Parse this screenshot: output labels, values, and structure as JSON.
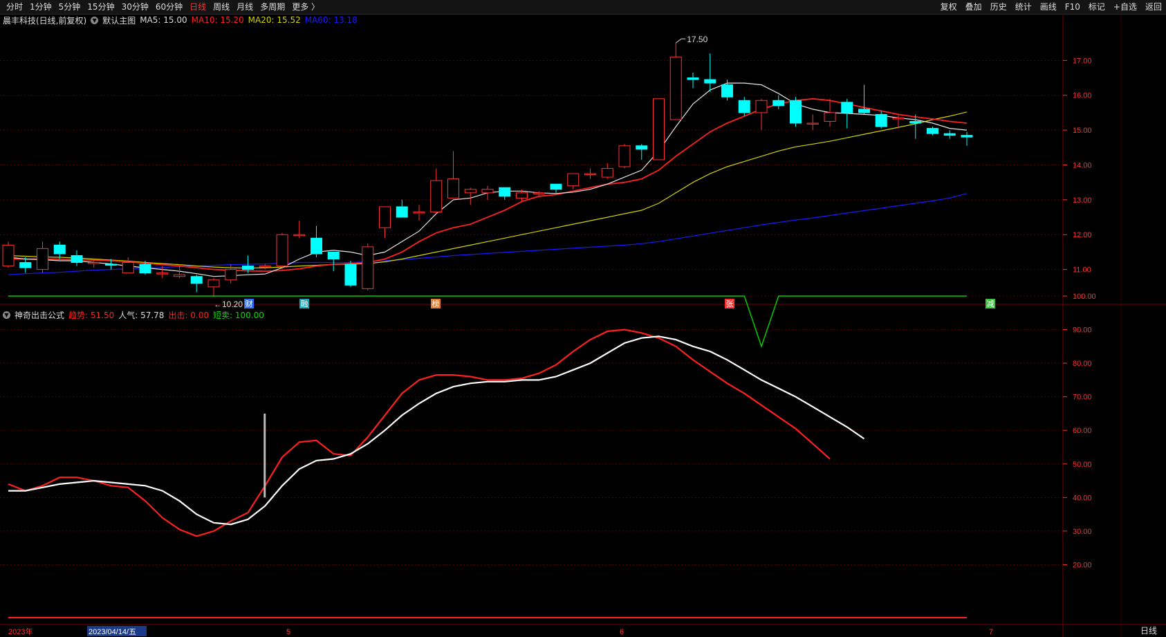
{
  "toolbar": {
    "periods": [
      "分时",
      "1分钟",
      "5分钟",
      "15分钟",
      "30分钟",
      "60分钟",
      "日线",
      "周线",
      "月线",
      "多周期",
      "更多 〉"
    ],
    "active_period": "日线",
    "right_buttons": [
      "复权",
      "叠加",
      "历史",
      "统计",
      "画线",
      "F10",
      "标记",
      "+自选",
      "返回"
    ]
  },
  "main_header": {
    "stock": "晨丰科技(日线,前复权)",
    "chart_name": "默认主图",
    "ma5": "MA5: 15.00",
    "ma10": "MA10: 15.20",
    "ma20": "MA20: 15.52",
    "ma60": "MA60: 13.18"
  },
  "indicator_header": {
    "name": "神奇出击公式",
    "trend": "趋势: 51.50",
    "popularity": "人气: 57.78",
    "attack": "出击: 0.00",
    "short_sell": "短卖: 100.00"
  },
  "colors": {
    "up": "#ff3232",
    "down": "#00ffff",
    "ma5": "#e8e8e8",
    "ma10": "#ff2020",
    "ma20": "#d4d400",
    "ma60": "#1a1aff",
    "grid": "#5a0000",
    "axis": "#ff3232",
    "short_sell": "#00cc00"
  },
  "price_axis": {
    "ticks": [
      "17.00",
      "16.00",
      "15.00",
      "14.00",
      "13.00",
      "12.00",
      "11.00"
    ]
  },
  "indicator_axis": {
    "ticks": [
      "100.00",
      "90.00",
      "80.00",
      "70.00",
      "60.00",
      "50.00",
      "40.00",
      "30.00",
      "20.00"
    ]
  },
  "annotations": {
    "high": "17.50",
    "low": "10.20"
  },
  "event_markers": [
    "财",
    "融",
    "榜",
    "张",
    "减"
  ],
  "date_axis": {
    "labels": [
      "2023年",
      "2023/04/14/五",
      "5",
      "6",
      "7"
    ]
  },
  "period_button": "日线",
  "chart_data": {
    "type": "candlestick",
    "candles": [
      {
        "o": 11.1,
        "c": 11.7,
        "h": 11.8,
        "l": 11.05
      },
      {
        "o": 11.2,
        "c": 11.05,
        "h": 11.35,
        "l": 10.9
      },
      {
        "o": 11.0,
        "c": 11.6,
        "h": 11.8,
        "l": 10.9
      },
      {
        "o": 11.7,
        "c": 11.45,
        "h": 11.8,
        "l": 11.3
      },
      {
        "o": 11.4,
        "c": 11.2,
        "h": 11.55,
        "l": 11.1
      },
      {
        "o": 11.2,
        "c": 11.2,
        "h": 11.3,
        "l": 11.05
      },
      {
        "o": 11.15,
        "c": 11.12,
        "h": 11.3,
        "l": 11.0
      },
      {
        "o": 10.9,
        "c": 11.2,
        "h": 11.35,
        "l": 10.9
      },
      {
        "o": 11.15,
        "c": 10.9,
        "h": 11.25,
        "l": 10.85
      },
      {
        "o": 10.9,
        "c": 10.9,
        "h": 11.1,
        "l": 10.75
      },
      {
        "o": 10.8,
        "c": 10.85,
        "h": 11.15,
        "l": 10.75
      },
      {
        "o": 10.8,
        "c": 10.6,
        "h": 10.85,
        "l": 10.35
      },
      {
        "o": 10.5,
        "c": 10.7,
        "h": 10.75,
        "l": 10.2
      },
      {
        "o": 10.7,
        "c": 11.0,
        "h": 11.15,
        "l": 10.6
      },
      {
        "o": 11.1,
        "c": 11.0,
        "h": 11.4,
        "l": 10.9
      },
      {
        "o": 11.1,
        "c": 11.1,
        "h": 11.15,
        "l": 11.0
      },
      {
        "o": 11.1,
        "c": 12.0,
        "h": 12.05,
        "l": 11.0
      },
      {
        "o": 12.0,
        "c": 12.0,
        "h": 12.4,
        "l": 11.9
      },
      {
        "o": 11.9,
        "c": 11.45,
        "h": 12.25,
        "l": 11.35
      },
      {
        "o": 11.5,
        "c": 11.3,
        "h": 11.5,
        "l": 10.95
      },
      {
        "o": 11.15,
        "c": 10.55,
        "h": 11.25,
        "l": 10.5
      },
      {
        "o": 10.45,
        "c": 11.65,
        "h": 11.75,
        "l": 10.4
      },
      {
        "o": 12.2,
        "c": 12.8,
        "h": 12.8,
        "l": 11.9
      },
      {
        "o": 12.8,
        "c": 12.5,
        "h": 13.0,
        "l": 12.5
      },
      {
        "o": 12.65,
        "c": 12.65,
        "h": 12.85,
        "l": 12.4
      },
      {
        "o": 12.65,
        "c": 13.55,
        "h": 13.9,
        "l": 12.6
      },
      {
        "o": 13.05,
        "c": 13.6,
        "h": 14.4,
        "l": 13.05
      },
      {
        "o": 13.2,
        "c": 13.3,
        "h": 13.35,
        "l": 12.85
      },
      {
        "o": 13.2,
        "c": 13.3,
        "h": 13.4,
        "l": 13.0
      },
      {
        "o": 13.35,
        "c": 13.1,
        "h": 13.35,
        "l": 13.0
      },
      {
        "o": 13.05,
        "c": 13.2,
        "h": 13.3,
        "l": 12.95
      },
      {
        "o": 13.2,
        "c": 13.2,
        "h": 13.25,
        "l": 13.1
      },
      {
        "o": 13.45,
        "c": 13.3,
        "h": 13.45,
        "l": 13.2
      },
      {
        "o": 13.4,
        "c": 13.75,
        "h": 13.75,
        "l": 13.3
      },
      {
        "o": 13.75,
        "c": 13.75,
        "h": 13.9,
        "l": 13.6
      },
      {
        "o": 13.65,
        "c": 13.9,
        "h": 14.05,
        "l": 13.6
      },
      {
        "o": 13.95,
        "c": 14.55,
        "h": 14.6,
        "l": 13.9
      },
      {
        "o": 14.55,
        "c": 14.45,
        "h": 14.6,
        "l": 14.15
      },
      {
        "o": 14.15,
        "c": 15.9,
        "h": 15.9,
        "l": 14.15
      },
      {
        "o": 15.3,
        "c": 17.1,
        "h": 17.5,
        "l": 15.3
      },
      {
        "o": 16.5,
        "c": 16.45,
        "h": 16.65,
        "l": 16.2
      },
      {
        "o": 16.45,
        "c": 16.35,
        "h": 17.2,
        "l": 16.1
      },
      {
        "o": 16.3,
        "c": 15.95,
        "h": 16.45,
        "l": 15.85
      },
      {
        "o": 15.85,
        "c": 15.5,
        "h": 15.95,
        "l": 15.4
      },
      {
        "o": 15.5,
        "c": 15.85,
        "h": 15.9,
        "l": 15.0
      },
      {
        "o": 15.85,
        "c": 15.7,
        "h": 16.0,
        "l": 15.6
      },
      {
        "o": 15.85,
        "c": 15.2,
        "h": 15.95,
        "l": 15.1
      },
      {
        "o": 15.2,
        "c": 15.2,
        "h": 15.45,
        "l": 15.0
      },
      {
        "o": 15.25,
        "c": 15.5,
        "h": 15.9,
        "l": 15.1
      },
      {
        "o": 15.8,
        "c": 15.5,
        "h": 15.9,
        "l": 15.05
      },
      {
        "o": 15.6,
        "c": 15.5,
        "h": 16.3,
        "l": 15.45
      },
      {
        "o": 15.45,
        "c": 15.1,
        "h": 15.55,
        "l": 15.05
      },
      {
        "o": 15.35,
        "c": 15.35,
        "h": 15.45,
        "l": 15.05
      },
      {
        "o": 15.25,
        "c": 15.2,
        "h": 15.45,
        "l": 14.75
      },
      {
        "o": 15.05,
        "c": 14.9,
        "h": 15.1,
        "l": 14.85
      },
      {
        "o": 14.9,
        "c": 14.85,
        "h": 15.0,
        "l": 14.75
      },
      {
        "o": 14.85,
        "c": 14.8,
        "h": 14.95,
        "l": 14.55
      }
    ],
    "ma5": [
      11.35,
      11.3,
      11.28,
      11.25,
      11.25,
      11.2,
      11.16,
      11.1,
      11.05,
      11.0,
      10.95,
      10.88,
      10.8,
      10.82,
      10.85,
      10.87,
      11.05,
      11.3,
      11.5,
      11.55,
      11.5,
      11.4,
      11.5,
      11.8,
      12.1,
      12.6,
      13.0,
      13.05,
      13.2,
      13.25,
      13.25,
      13.2,
      13.18,
      13.22,
      13.3,
      13.45,
      13.65,
      13.85,
      14.4,
      15.1,
      15.75,
      16.15,
      16.35,
      16.35,
      16.3,
      16.05,
      15.75,
      15.6,
      15.5,
      15.48,
      15.45,
      15.42,
      15.35,
      15.3,
      15.2,
      15.05,
      15.0
    ],
    "ma10": [
      11.3,
      11.3,
      11.3,
      11.29,
      11.28,
      11.27,
      11.25,
      11.22,
      11.18,
      11.14,
      11.1,
      11.05,
      11.0,
      10.98,
      10.96,
      10.95,
      10.97,
      11.02,
      11.1,
      11.15,
      11.17,
      11.2,
      11.3,
      11.5,
      11.8,
      12.05,
      12.2,
      12.3,
      12.5,
      12.7,
      12.95,
      13.1,
      13.15,
      13.25,
      13.35,
      13.45,
      13.5,
      13.6,
      13.85,
      14.25,
      14.6,
      14.95,
      15.2,
      15.4,
      15.6,
      15.75,
      15.85,
      15.9,
      15.85,
      15.75,
      15.65,
      15.55,
      15.45,
      15.38,
      15.32,
      15.25,
      15.2
    ],
    "ma20": [
      11.4,
      11.38,
      11.36,
      11.35,
      11.33,
      11.3,
      11.27,
      11.24,
      11.2,
      11.17,
      11.14,
      11.1,
      11.07,
      11.05,
      11.04,
      11.05,
      11.07,
      11.1,
      11.12,
      11.15,
      11.15,
      11.17,
      11.22,
      11.3,
      11.4,
      11.5,
      11.6,
      11.7,
      11.8,
      11.9,
      12.0,
      12.1,
      12.2,
      12.3,
      12.4,
      12.5,
      12.6,
      12.7,
      12.9,
      13.2,
      13.5,
      13.75,
      13.95,
      14.1,
      14.25,
      14.4,
      14.52,
      14.6,
      14.68,
      14.78,
      14.88,
      14.98,
      15.08,
      15.18,
      15.3,
      15.4,
      15.52
    ],
    "ma60": [
      10.85,
      10.88,
      10.9,
      10.92,
      10.95,
      10.98,
      11.0,
      11.02,
      11.04,
      11.06,
      11.08,
      11.1,
      11.12,
      11.14,
      11.15,
      11.16,
      11.18,
      11.2,
      11.2,
      11.2,
      11.2,
      11.22,
      11.25,
      11.28,
      11.32,
      11.36,
      11.4,
      11.43,
      11.46,
      11.49,
      11.52,
      11.55,
      11.58,
      11.61,
      11.64,
      11.67,
      11.7,
      11.74,
      11.8,
      11.88,
      11.96,
      12.04,
      12.12,
      12.2,
      12.28,
      12.35,
      12.42,
      12.48,
      12.55,
      12.62,
      12.69,
      12.76,
      12.83,
      12.9,
      12.97,
      13.05,
      13.18
    ],
    "indicator": {
      "popularity": [
        42,
        42,
        43,
        44,
        44.5,
        45,
        44.5,
        44,
        43.5,
        42,
        39,
        35,
        32.5,
        32,
        33.5,
        37.5,
        43.5,
        48.5,
        51,
        51.5,
        53,
        56,
        60,
        64.5,
        68,
        71,
        73,
        74,
        74.5,
        74.5,
        75,
        75,
        76,
        78,
        80,
        83,
        86,
        87.5,
        88,
        87,
        85,
        83.5,
        81,
        78,
        75,
        72.5,
        70,
        67,
        64,
        61,
        57.5
      ],
      "trend": [
        44,
        42,
        43.5,
        46,
        46,
        45,
        43.5,
        43,
        39,
        34,
        30.5,
        28.5,
        30,
        33,
        35.5,
        43.5,
        52,
        56.5,
        57,
        53,
        52.5,
        58,
        64.5,
        71,
        75,
        76.5,
        76.5,
        76,
        75,
        75,
        75.5,
        77,
        79.5,
        83.5,
        87,
        89.5,
        90,
        89,
        87.5,
        85,
        81,
        77.5,
        74,
        71,
        67.5,
        64,
        60.5,
        56,
        51.5
      ],
      "short_sell": [
        100,
        100,
        100,
        100,
        100,
        100,
        100,
        100,
        100,
        100,
        100,
        100,
        100,
        100,
        100,
        100,
        100,
        100,
        100,
        100,
        100,
        100,
        100,
        100,
        100,
        100,
        100,
        100,
        100,
        100,
        100,
        100,
        100,
        100,
        100,
        100,
        100,
        100,
        100,
        100,
        100,
        100,
        100,
        100,
        85,
        100,
        100,
        100,
        100,
        100,
        100,
        100,
        100,
        100,
        100,
        100,
        100
      ],
      "attack_bar": {
        "index": 15,
        "top": 65,
        "bottom": 40
      },
      "ylim": [
        10,
        100
      ]
    },
    "ylim_price": [
      10.0,
      17.9
    ]
  }
}
